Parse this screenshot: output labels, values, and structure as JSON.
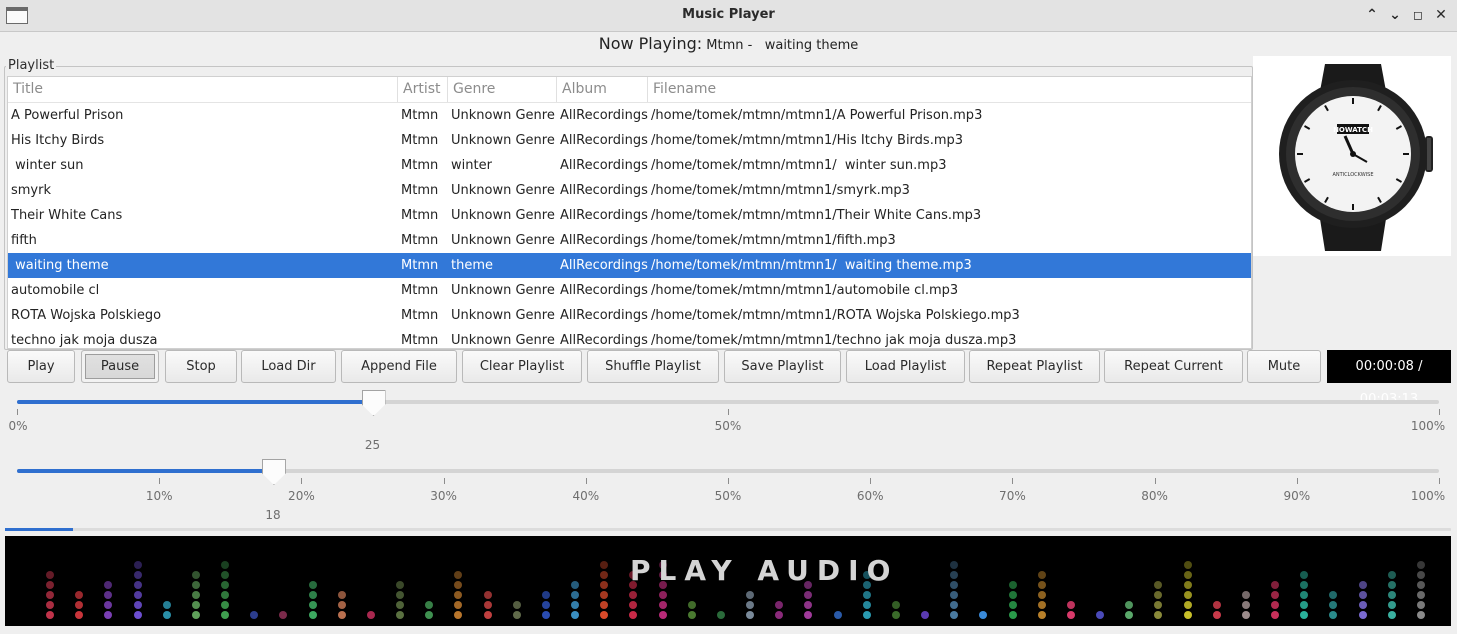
{
  "window": {
    "title": "Music Player"
  },
  "now_playing": {
    "label": "Now Playing:",
    "value": " Mtmn -   waiting theme"
  },
  "playlist": {
    "group_title": "Playlist",
    "columns": [
      "Title",
      "Artist",
      "Genre",
      "Album",
      "Filename"
    ],
    "selected_index": 6,
    "rows": [
      [
        "A Powerful Prison",
        "Mtmn",
        "Unknown Genre",
        "AllRecordings",
        "/home/tomek/mtmn/mtmn1/A Powerful Prison.mp3"
      ],
      [
        "His Itchy Birds",
        "Mtmn",
        "Unknown Genre",
        "AllRecordings",
        "/home/tomek/mtmn/mtmn1/His Itchy Birds.mp3"
      ],
      [
        " winter sun",
        "Mtmn",
        "winter",
        "AllRecordings",
        "/home/tomek/mtmn/mtmn1/  winter sun.mp3"
      ],
      [
        "smyrk",
        "Mtmn",
        "Unknown Genre",
        "AllRecordings",
        "/home/tomek/mtmn/mtmn1/smyrk.mp3"
      ],
      [
        "Their White Cans",
        "Mtmn",
        "Unknown Genre",
        "AllRecordings",
        "/home/tomek/mtmn/mtmn1/Their White Cans.mp3"
      ],
      [
        "fifth",
        "Mtmn",
        "Unknown Genre",
        "AllRecordings",
        "/home/tomek/mtmn/mtmn1/fifth.mp3"
      ],
      [
        " waiting theme",
        "Mtmn",
        "theme",
        "AllRecordings",
        "/home/tomek/mtmn/mtmn1/  waiting theme.mp3"
      ],
      [
        "automobile cl",
        "Mtmn",
        "Unknown Genre",
        "AllRecordings",
        "/home/tomek/mtmn/mtmn1/automobile cl.mp3"
      ],
      [
        "ROTA Wojska Polskiego",
        "Mtmn",
        "Unknown Genre",
        "AllRecordings",
        "/home/tomek/mtmn/mtmn1/ROTA Wojska Polskiego.mp3"
      ],
      [
        "techno jak moja dusza",
        "Mtmn",
        "Unknown Genre",
        "AllRecordings",
        "/home/tomek/mtmn/mtmn1/techno jak moja dusza.mp3"
      ]
    ]
  },
  "album_art": {
    "logo_text": "NOWATCH",
    "dial_text": "ANTICLOCKWISE"
  },
  "controls": {
    "buttons": [
      "Play",
      "Pause",
      "Stop",
      "Load Dir",
      "Append File",
      "Clear Playlist",
      "Shuffle Playlist",
      "Save Playlist",
      "Load Playlist",
      "Repeat Playlist",
      "Repeat Current",
      "Mute"
    ],
    "active_button": "Pause",
    "time": "00:00:08 / 00:03:13"
  },
  "volume_slider": {
    "value": 25,
    "value_label": "25",
    "tick_labels": [
      "0%",
      "50%",
      "100%"
    ]
  },
  "seek_slider": {
    "value": 18,
    "value_label": "18",
    "tick_labels": [
      "10%",
      "20%",
      "30%",
      "40%",
      "50%",
      "60%",
      "70%",
      "80%",
      "90%",
      "100%"
    ]
  },
  "playback_progress": {
    "fraction": 0.047
  },
  "visualizer": {
    "title": "PLAY AUDIO",
    "colors": [
      "#c0334a",
      "#c8353b",
      "#7a3fb4",
      "#6c4ed0",
      "#2a8fa8",
      "#5fa05a",
      "#3f9e4f",
      "#2c3d8c",
      "#7a2a4a",
      "#3da860",
      "#b9704f",
      "#a8284f",
      "#5a7040",
      "#3f9050",
      "#b8762c",
      "#c04040",
      "#606a4a",
      "#2a4cb0",
      "#3a8ec0",
      "#d84a2a",
      "#c82a48",
      "#b82a78",
      "#4a7a30",
      "#2a6a3a",
      "#7a8a9a",
      "#8a2a7a",
      "#a03a9a",
      "#2a5aa8",
      "#2a9ab0",
      "#3a6a2a",
      "#5a3ab0",
      "#4a7aa0",
      "#3a8ad8",
      "#2a9a4a",
      "#b8802a",
      "#d83a6a",
      "#4a4ab8",
      "#5aa86a",
      "#8a8a3a",
      "#c8c02a",
      "#c83a4a",
      "#9a8a8a",
      "#c8305a",
      "#2ab09a",
      "#2a8a8a",
      "#7a6ad0",
      "#3ab0a0",
      "#8a8a8a"
    ],
    "levels": [
      5,
      3,
      4,
      6,
      2,
      5,
      6,
      1,
      1,
      4,
      3,
      1,
      4,
      2,
      5,
      3,
      2,
      3,
      4,
      6,
      5,
      6,
      2,
      1,
      3,
      2,
      4,
      1,
      5,
      2,
      1,
      6,
      1,
      4,
      5,
      2,
      1,
      2,
      4,
      6,
      2,
      3,
      4,
      5,
      3,
      4,
      5,
      6
    ]
  }
}
